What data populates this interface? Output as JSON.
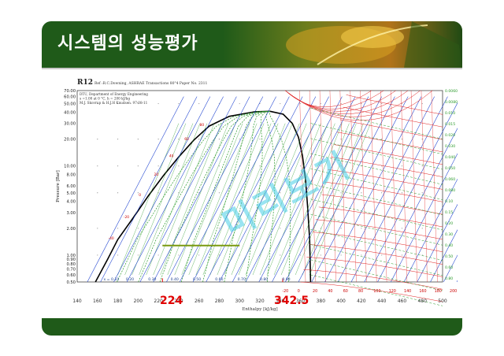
{
  "slide": {
    "title": "시스템의 성능평가",
    "header_color": "#1f5a19"
  },
  "diagram": {
    "chart_title": "R12",
    "subtitle": "Ref :R.C.Downing, ASHRAE Transactions 80\"4 Paper No. 2311",
    "credits": [
      "DTU, Department of Energy Engineering",
      "s =1.00 at 0 °C, h = 200 kJ/kg",
      "M.J. Skovrup & H.J.H Knudsen. 97-08-11"
    ],
    "y_axis_label": "Pressure [Bar]",
    "y_ticks": [
      "70.00",
      "60.00",
      "50.00",
      "40.00",
      "30.00",
      "20.00",
      "10.00",
      "8.00",
      "6.00",
      "5.00",
      "4.00",
      "3.00",
      "2.00",
      "1.00",
      "0.90",
      "0.80",
      "0.70",
      "0.60",
      "0.50"
    ],
    "x_axis_label": "Enthalpy [kJ/kg]",
    "x_ticks": [
      "140",
      "160",
      "180",
      "200",
      "220",
      "240",
      "260",
      "280",
      "300",
      "320",
      "340",
      "360",
      "380",
      "400",
      "420",
      "440",
      "460",
      "480",
      "500"
    ],
    "quality_ticks": [
      "x = 0.10",
      "0.20",
      "0.30",
      "0.40",
      "0.50",
      "0.60",
      "0.70",
      "0.80",
      "0.90"
    ],
    "right_volume_ticks": [
      "0.0060",
      "0.0080",
      "0.010",
      "0.015",
      "0.020",
      "0.030",
      "0.040",
      "0.050",
      "0.060",
      "0.080",
      "0.10",
      "0.15",
      "0.20",
      "0.30",
      "0.40",
      "0.50",
      "0.60",
      "0.80"
    ],
    "bottom_temp_ticks": [
      "-20",
      "0",
      "20",
      "40",
      "60",
      "80",
      "100",
      "120",
      "140",
      "160",
      "180",
      "200"
    ],
    "left_temp_ticks": [
      "-40",
      "-20",
      "0",
      "20",
      "40",
      "60",
      "80"
    ],
    "highlight_h1": "224",
    "highlight_h2": "342.5",
    "watermark": "미리보기",
    "colors": {
      "entropy": "#1a3fcf",
      "temperature": "#e02020",
      "volume": "#2a9a2a",
      "saturation": "#000000",
      "process": "#7a9a10",
      "highlight": "#e00000"
    }
  }
}
